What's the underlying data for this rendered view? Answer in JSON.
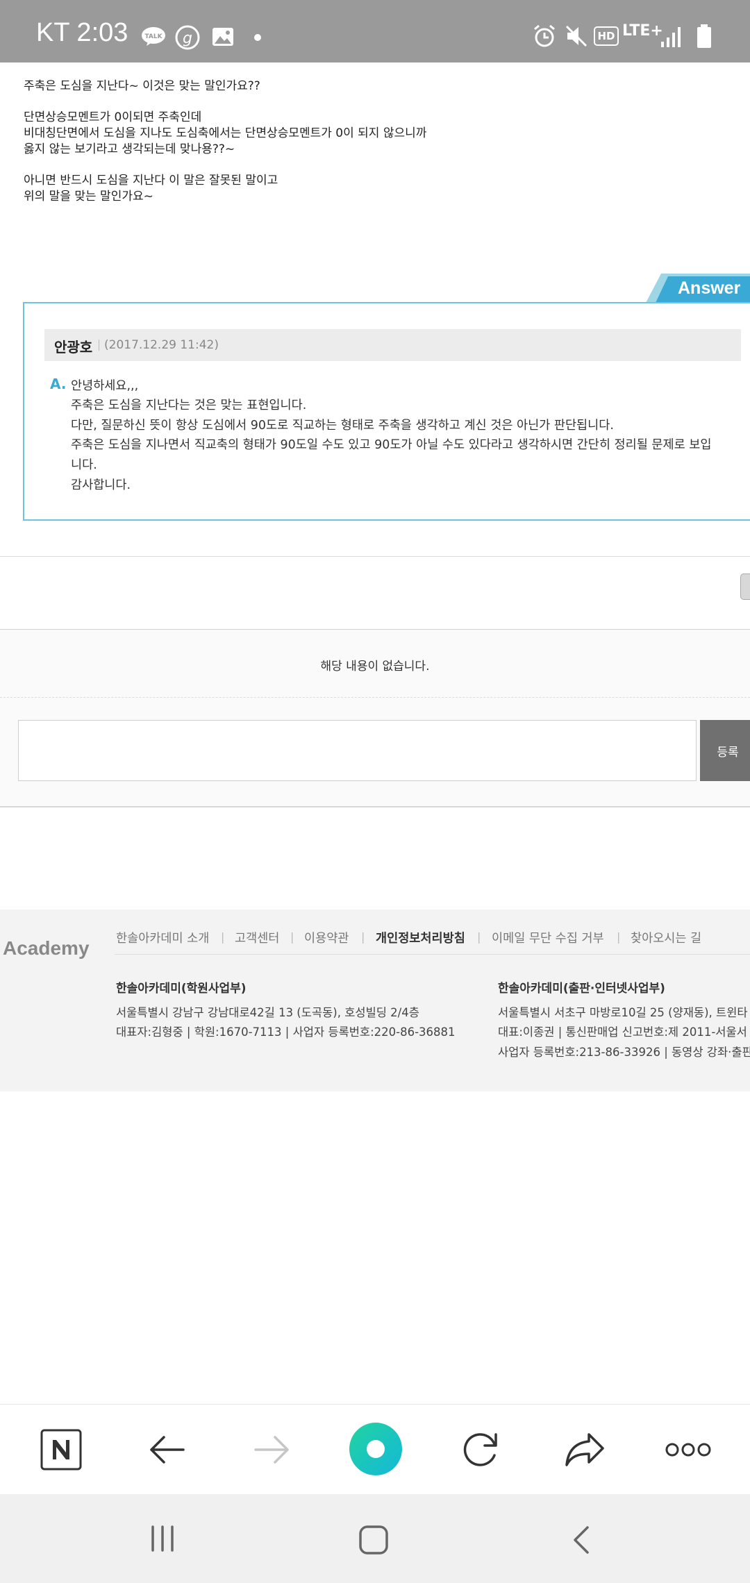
{
  "status_bar": {
    "carrier_time": "KT 2:03",
    "talk_badge": "TALK",
    "network": "LTE+",
    "hd": "HD"
  },
  "question": {
    "lines": [
      "주축은 도심을 지난다~ 이것은 맞는 말인가요??",
      "",
      "단면상승모멘트가 0이되면 주축인데",
      "비대칭단면에서 도심을 지나도 도심축에서는 단면상승모멘트가 0이 되지 않으니까",
      "옳지 않는 보기라고 생각되는데 맞나용??~",
      "",
      "아니면 반드시 도심을 지난다 이 말은 잘못된 말이고",
      "위의 말을 맞는 말인가요~"
    ]
  },
  "answer": {
    "tab_label": "Answer",
    "author": "안광호",
    "date": "(2017.12.29 11:42)",
    "mark": "A.",
    "lines": [
      "안녕하세요,,,",
      "주축은 도심을 지난다는 것은 맞는 표현입니다.",
      "다만, 질문하신 뜻이 항상 도심에서 90도로 직교하는 형태로 주축을 생각하고 계신 것은 아닌가 판단됩니다.",
      "주축은 도심을 지나면서 직교축의 형태가 90도일 수도 있고 90도가 아닐 수도 있다라고 생각하시면 간단히 정리될 문제로 보입",
      "니다.",
      "감사합니다."
    ]
  },
  "comments": {
    "empty_message": "해당 내용이 없습니다.",
    "submit_label": "등록",
    "input_value": ""
  },
  "footer": {
    "logo": "Academy",
    "nav": [
      "한솔아카데미 소개",
      "고객센터",
      "이용약관",
      "개인정보처리방침",
      "이메일 무단 수집 거부",
      "찾아오시는 길"
    ],
    "left": {
      "title": "한솔아카데미(학원사업부)",
      "line1": "서울특별시 강남구 강남대로42길 13 (도곡동), 호성빌딩 2/4층",
      "line2": "대표자:김형중 | 학원:1670-7113 | 사업자 등록번호:220-86-36881"
    },
    "right": {
      "title": "한솔아카데미(출판·인터넷사업부)",
      "line1": "서울특별시 서초구 마방로10길 25 (양재동), 트윈타",
      "line2": "대표:이종권 | 통신판매업 신고번호:제 2011-서울서",
      "line3": "사업자 등록번호:213-86-33926 | 동영상 강좌·출판"
    }
  },
  "colors": {
    "status_bar": "#9a9a9a",
    "answer_accent": "#3aa9d6",
    "answer_border": "#6cc5d8",
    "home_button_gradient": [
      "#22d3a0",
      "#14b8d8"
    ]
  }
}
